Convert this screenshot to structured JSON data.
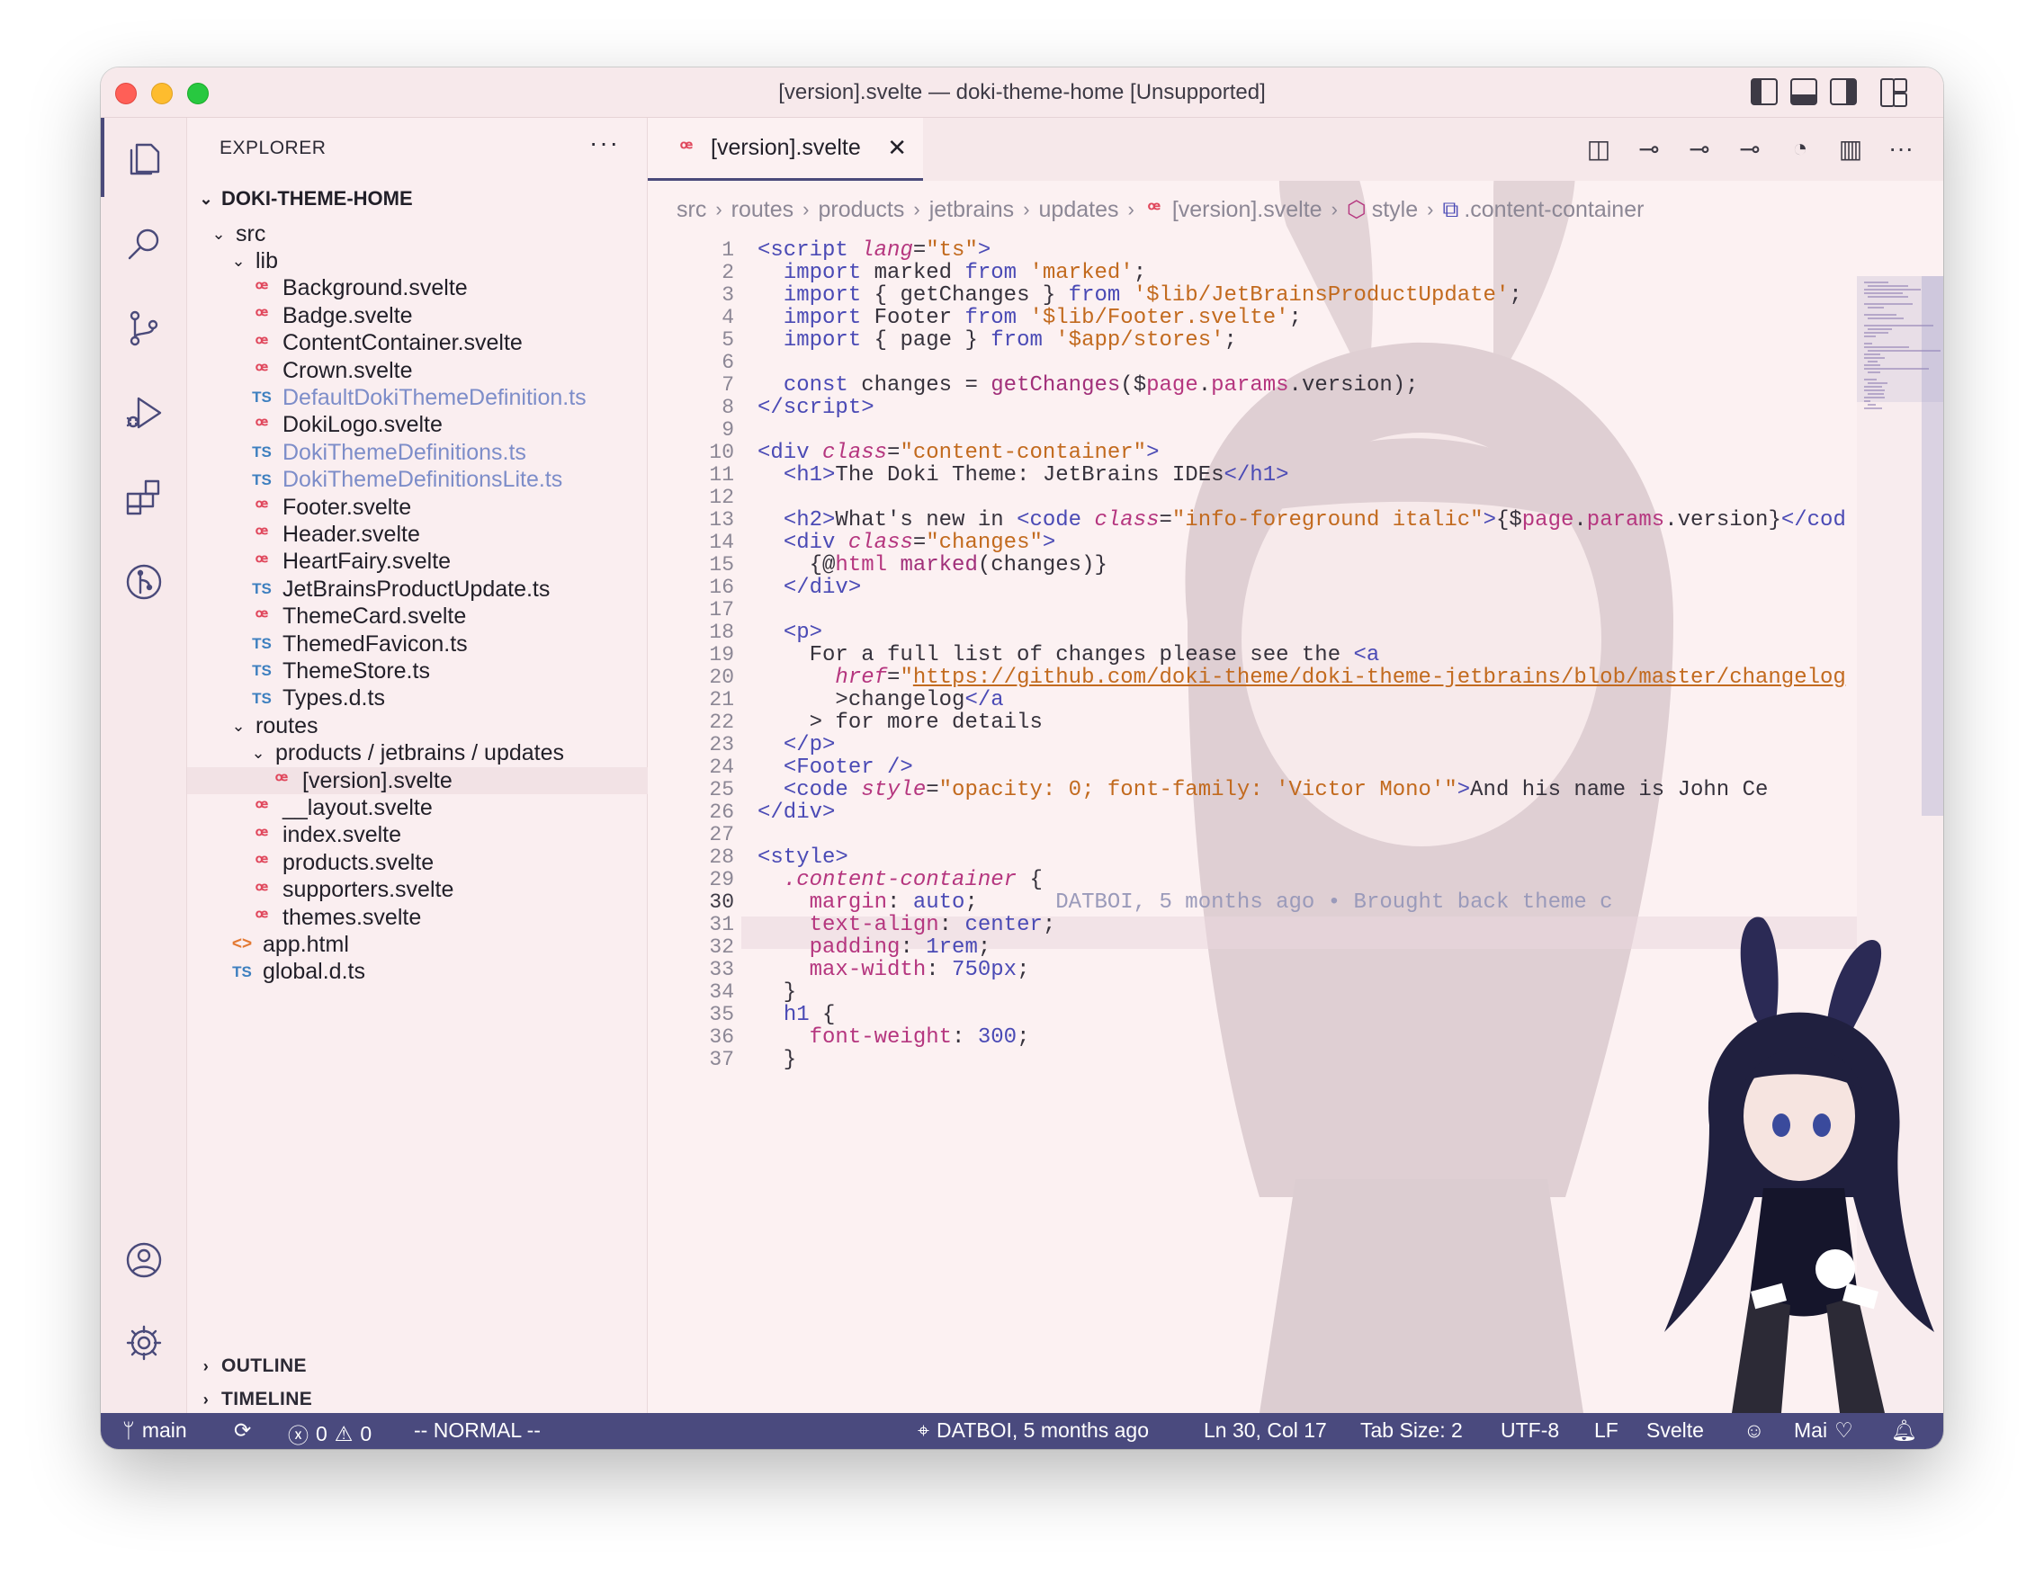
{
  "window": {
    "title": "[version].svelte — doki-theme-home [Unsupported]"
  },
  "sidebar": {
    "header": "EXPLORER",
    "more": "···",
    "root": "DOKI-THEME-HOME",
    "tree": [
      {
        "label": "src",
        "type": "folder",
        "depth": 0
      },
      {
        "label": "lib",
        "type": "folder",
        "depth": 1
      },
      {
        "label": "Background.svelte",
        "type": "svelte",
        "depth": 2
      },
      {
        "label": "Badge.svelte",
        "type": "svelte",
        "depth": 2
      },
      {
        "label": "ContentContainer.svelte",
        "type": "svelte",
        "depth": 2
      },
      {
        "label": "Crown.svelte",
        "type": "svelte",
        "depth": 2
      },
      {
        "label": "DefaultDokiThemeDefinition.ts",
        "type": "ts",
        "depth": 2,
        "dim": true
      },
      {
        "label": "DokiLogo.svelte",
        "type": "svelte",
        "depth": 2
      },
      {
        "label": "DokiThemeDefinitions.ts",
        "type": "ts",
        "depth": 2,
        "dim": true
      },
      {
        "label": "DokiThemeDefinitionsLite.ts",
        "type": "ts",
        "depth": 2,
        "dim": true
      },
      {
        "label": "Footer.svelte",
        "type": "svelte",
        "depth": 2
      },
      {
        "label": "Header.svelte",
        "type": "svelte",
        "depth": 2
      },
      {
        "label": "HeartFairy.svelte",
        "type": "svelte",
        "depth": 2
      },
      {
        "label": "JetBrainsProductUpdate.ts",
        "type": "ts",
        "depth": 2
      },
      {
        "label": "ThemeCard.svelte",
        "type": "svelte",
        "depth": 2
      },
      {
        "label": "ThemedFavicon.ts",
        "type": "ts",
        "depth": 2
      },
      {
        "label": "ThemeStore.ts",
        "type": "ts",
        "depth": 2
      },
      {
        "label": "Types.d.ts",
        "type": "ts",
        "depth": 2
      },
      {
        "label": "routes",
        "type": "folder",
        "depth": 1
      },
      {
        "label": "products / jetbrains / updates",
        "type": "folder",
        "depth": 2
      },
      {
        "label": "[version].svelte",
        "type": "svelte",
        "depth": 3,
        "selected": true
      },
      {
        "label": "__layout.svelte",
        "type": "svelte",
        "depth": 2
      },
      {
        "label": "index.svelte",
        "type": "svelte",
        "depth": 2
      },
      {
        "label": "products.svelte",
        "type": "svelte",
        "depth": 2
      },
      {
        "label": "supporters.svelte",
        "type": "svelte",
        "depth": 2
      },
      {
        "label": "themes.svelte",
        "type": "svelte",
        "depth": 2
      },
      {
        "label": "app.html",
        "type": "html",
        "depth": 1
      },
      {
        "label": "global.d.ts",
        "type": "ts",
        "depth": 1
      }
    ],
    "outline": "OUTLINE",
    "timeline": "TIMELINE"
  },
  "editor": {
    "tab_label": "[version].svelte",
    "tab_close": "✕",
    "breadcrumb": [
      "src",
      "routes",
      "products",
      "jetbrains",
      "updates",
      "[version].svelte",
      "style",
      ".content-container"
    ],
    "blame": "DATBOI, 5 months ago • Brought back theme c",
    "line_numbers": [
      "1",
      "2",
      "3",
      "4",
      "5",
      "6",
      "7",
      "8",
      "9",
      "10",
      "11",
      "12",
      "13",
      "14",
      "15",
      "16",
      "17",
      "18",
      "19",
      "20",
      "21",
      "22",
      "23",
      "24",
      "25",
      "26",
      "27",
      "28",
      "29",
      "30",
      "31",
      "32",
      "33",
      "34",
      "35",
      "36",
      "37"
    ],
    "current_line": "30"
  },
  "statusbar": {
    "branch": "main",
    "errors": "0",
    "warnings": "0",
    "mode": "-- NORMAL --",
    "git_blame": "DATBOI, 5 months ago",
    "position": "Ln 30, Col 17",
    "tab_size": "Tab Size: 2",
    "encoding": "UTF-8",
    "eol": "LF",
    "language": "Svelte",
    "user": "Mai"
  },
  "colors": {
    "accent": "#4a4a7e",
    "background": "#fcf1f2",
    "svelte": "#e0475c",
    "typescript": "#3d7fbf"
  }
}
